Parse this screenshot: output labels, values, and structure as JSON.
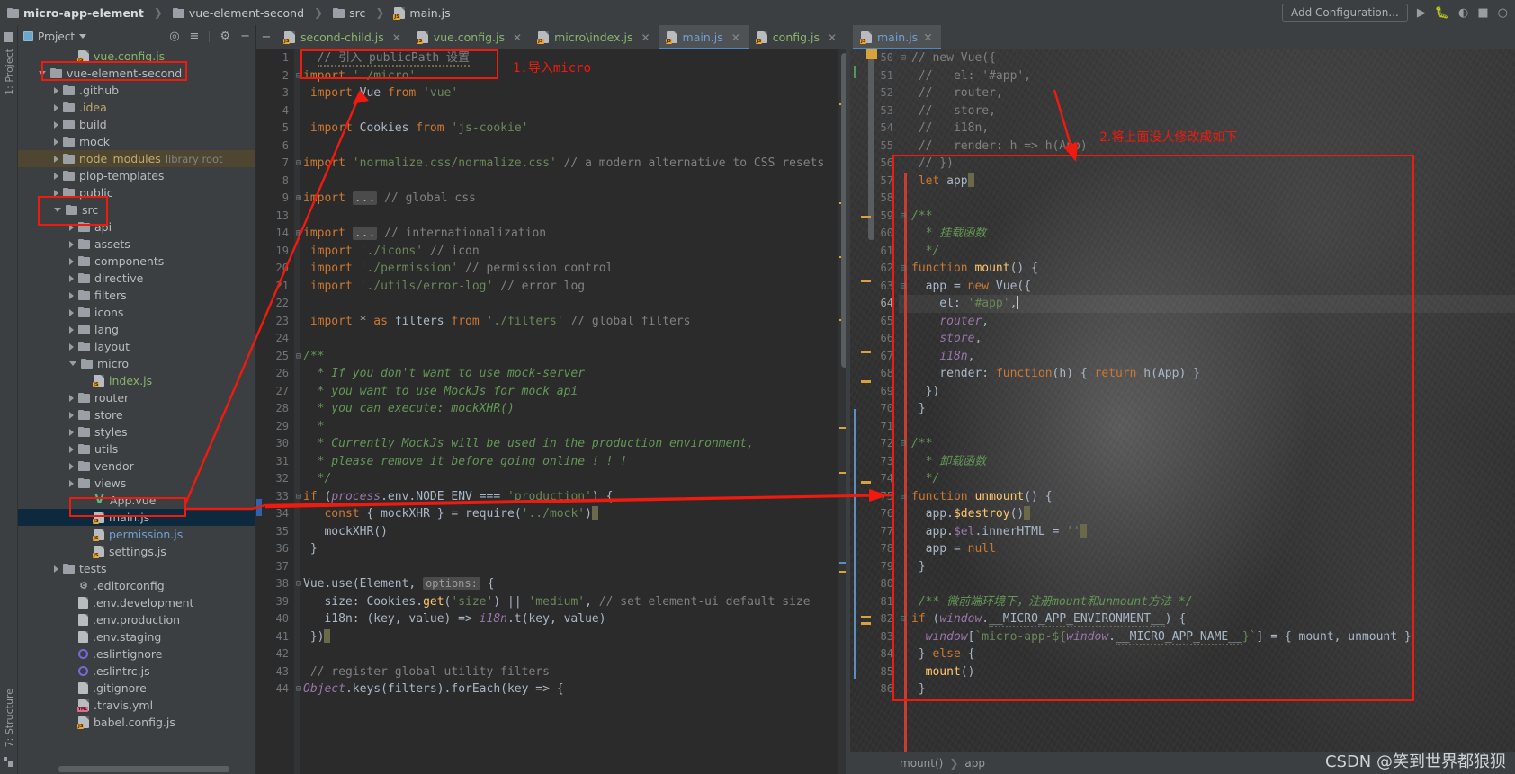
{
  "window": {
    "breadcrumb": [
      "micro-app-element",
      "vue-element-second",
      "src",
      "main.js"
    ],
    "add_configuration": "Add Configuration...",
    "run_icon": "run-icon",
    "debug_icon": "debug-icon",
    "coverage_icon": "run-with-coverage-icon",
    "stop_icon": "stop-icon",
    "search_icon": "search-icon"
  },
  "left_strip": {
    "project_label": "1: Project",
    "structure_label": "7: Structure"
  },
  "project_panel": {
    "title": "Project",
    "actions": [
      "locate-icon",
      "collapse-all-icon",
      "gear-icon",
      "hide-icon"
    ],
    "tree": [
      {
        "label": "vue.config.js",
        "indent": 3,
        "arrow": "none",
        "icon": "js",
        "color": "green"
      },
      {
        "label": "vue-element-second",
        "indent": 1,
        "arrow": "open",
        "icon": "folder",
        "color": "plain"
      },
      {
        "label": ".github",
        "indent": 2,
        "arrow": "closed",
        "icon": "folder",
        "color": "plain"
      },
      {
        "label": ".idea",
        "indent": 2,
        "arrow": "closed",
        "icon": "folder",
        "color": "yellow"
      },
      {
        "label": "build",
        "indent": 2,
        "arrow": "closed",
        "icon": "folder",
        "color": "plain"
      },
      {
        "label": "mock",
        "indent": 2,
        "arrow": "closed",
        "icon": "folder",
        "color": "plain"
      },
      {
        "label": "node_modules",
        "sub": "library root",
        "indent": 2,
        "arrow": "closed",
        "icon": "folder",
        "color": "yellow",
        "highlight": true
      },
      {
        "label": "plop-templates",
        "indent": 2,
        "arrow": "closed",
        "icon": "folder",
        "color": "plain"
      },
      {
        "label": "public",
        "indent": 2,
        "arrow": "closed",
        "icon": "folder",
        "color": "plain"
      },
      {
        "label": "src",
        "indent": 2,
        "arrow": "open",
        "icon": "folder",
        "color": "plain"
      },
      {
        "label": "api",
        "indent": 3,
        "arrow": "closed",
        "icon": "folder",
        "color": "plain"
      },
      {
        "label": "assets",
        "indent": 3,
        "arrow": "closed",
        "icon": "folder",
        "color": "plain"
      },
      {
        "label": "components",
        "indent": 3,
        "arrow": "closed",
        "icon": "folder",
        "color": "plain"
      },
      {
        "label": "directive",
        "indent": 3,
        "arrow": "closed",
        "icon": "folder",
        "color": "plain"
      },
      {
        "label": "filters",
        "indent": 3,
        "arrow": "closed",
        "icon": "folder",
        "color": "plain"
      },
      {
        "label": "icons",
        "indent": 3,
        "arrow": "closed",
        "icon": "folder",
        "color": "plain"
      },
      {
        "label": "lang",
        "indent": 3,
        "arrow": "closed",
        "icon": "folder",
        "color": "plain"
      },
      {
        "label": "layout",
        "indent": 3,
        "arrow": "closed",
        "icon": "folder",
        "color": "plain"
      },
      {
        "label": "micro",
        "indent": 3,
        "arrow": "open",
        "icon": "folder",
        "color": "plain"
      },
      {
        "label": "index.js",
        "indent": 4,
        "arrow": "none",
        "icon": "js",
        "color": "green"
      },
      {
        "label": "router",
        "indent": 3,
        "arrow": "closed",
        "icon": "folder",
        "color": "plain"
      },
      {
        "label": "store",
        "indent": 3,
        "arrow": "closed",
        "icon": "folder",
        "color": "plain"
      },
      {
        "label": "styles",
        "indent": 3,
        "arrow": "closed",
        "icon": "folder",
        "color": "plain"
      },
      {
        "label": "utils",
        "indent": 3,
        "arrow": "closed",
        "icon": "folder",
        "color": "plain"
      },
      {
        "label": "vendor",
        "indent": 3,
        "arrow": "closed",
        "icon": "folder",
        "color": "plain"
      },
      {
        "label": "views",
        "indent": 3,
        "arrow": "closed",
        "icon": "folder",
        "color": "plain"
      },
      {
        "label": "App.vue",
        "indent": 4,
        "arrow": "none",
        "icon": "vue",
        "color": "plain"
      },
      {
        "label": "main.js",
        "indent": 4,
        "arrow": "none",
        "icon": "js",
        "color": "plain",
        "selected": true
      },
      {
        "label": "permission.js",
        "indent": 4,
        "arrow": "none",
        "icon": "js",
        "color": "blue"
      },
      {
        "label": "settings.js",
        "indent": 4,
        "arrow": "none",
        "icon": "js",
        "color": "plain"
      },
      {
        "label": "tests",
        "indent": 2,
        "arrow": "closed",
        "icon": "folder",
        "color": "plain"
      },
      {
        "label": ".editorconfig",
        "indent": 3,
        "arrow": "none",
        "icon": "gear",
        "color": "plain"
      },
      {
        "label": ".env.development",
        "indent": 3,
        "arrow": "none",
        "icon": "doc",
        "color": "plain"
      },
      {
        "label": ".env.production",
        "indent": 3,
        "arrow": "none",
        "icon": "doc",
        "color": "plain"
      },
      {
        "label": ".env.staging",
        "indent": 3,
        "arrow": "none",
        "icon": "doc",
        "color": "plain"
      },
      {
        "label": ".eslintignore",
        "indent": 3,
        "arrow": "none",
        "icon": "circle",
        "color": "plain"
      },
      {
        "label": ".eslintrc.js",
        "indent": 3,
        "arrow": "none",
        "icon": "circle",
        "color": "plain"
      },
      {
        "label": ".gitignore",
        "indent": 3,
        "arrow": "none",
        "icon": "gitdoc",
        "color": "plain"
      },
      {
        "label": ".travis.yml",
        "indent": 3,
        "arrow": "none",
        "icon": "yml",
        "color": "plain"
      },
      {
        "label": "babel.config.js",
        "indent": 3,
        "arrow": "none",
        "icon": "js",
        "color": "plain"
      }
    ]
  },
  "tabs": [
    {
      "label": "second-child.js",
      "color": "green",
      "active": false
    },
    {
      "label": "vue.config.js",
      "color": "green",
      "active": false
    },
    {
      "label": "micro\\index.js",
      "color": "green",
      "active": false
    },
    {
      "label": "main.js",
      "color": "blue",
      "active": true
    },
    {
      "label": "config.js",
      "color": "green",
      "active": false
    }
  ],
  "right_tab": {
    "label": "main.js",
    "color": "blue"
  },
  "left_editor": {
    "lines": [
      {
        "n": "1",
        "fold": "",
        "html": "  <span class='cmt sq-wavy'>// 引入 publicPath 设置</span>"
      },
      {
        "n": "2",
        "fold": "-",
        "html": "<span class='kw'>import</span> <span class='str'>'./micro'</span>"
      },
      {
        "n": "3",
        "fold": "",
        "html": " <span class='kw'>import</span> Vue <span class='kw'>from</span> <span class='str'>'vue'</span>"
      },
      {
        "n": "4",
        "fold": "",
        "html": ""
      },
      {
        "n": "5",
        "fold": "",
        "html": " <span class='kw'>import</span> Cookies <span class='kw'>from</span> <span class='str'>'js-cookie'</span>"
      },
      {
        "n": "6",
        "fold": "",
        "html": ""
      },
      {
        "n": "7",
        "fold": "-",
        "html": "<span class='kw'>import</span> <span class='str'>'normalize.css/normalize.css'</span> <span class='cmt'>// a modern alternative to CSS resets</span>"
      },
      {
        "n": "8",
        "fold": "",
        "html": ""
      },
      {
        "n": "9",
        "fold": "+",
        "html": "<span class='kw'>import</span> <span class='folded'>...</span> <span class='cmt'>// global css</span>"
      },
      {
        "n": "13",
        "fold": "",
        "html": ""
      },
      {
        "n": "14",
        "fold": "+",
        "html": "<span class='kw'>import</span> <span class='folded'>...</span> <span class='cmt'>// internationalization</span>"
      },
      {
        "n": "19",
        "fold": "",
        "html": " <span class='kw'>import</span> <span class='str'>'./icons'</span> <span class='cmt'>// icon</span>"
      },
      {
        "n": "20",
        "fold": "",
        "html": " <span class='kw'>import</span> <span class='str'>'./permission'</span> <span class='cmt'>// permission control</span>"
      },
      {
        "n": "21",
        "fold": "",
        "html": " <span class='kw'>import</span> <span class='str'>'./utils/error-log'</span> <span class='cmt'>// error log</span>"
      },
      {
        "n": "22",
        "fold": "",
        "html": ""
      },
      {
        "n": "23",
        "fold": "",
        "html": " <span class='kw'>import</span> * <span class='kw'>as</span> filters <span class='kw'>from</span> <span class='str'>'./filters'</span> <span class='cmt'>// global filters</span>"
      },
      {
        "n": "24",
        "fold": "",
        "html": ""
      },
      {
        "n": "25",
        "fold": "-",
        "html": "<span class='cmt-doc'>/**</span>"
      },
      {
        "n": "26",
        "fold": "",
        "html": " <span class='cmt-doc'> * If you don't want to use mock-server</span>"
      },
      {
        "n": "27",
        "fold": "",
        "html": " <span class='cmt-doc'> * you want to use MockJs for mock api</span>"
      },
      {
        "n": "28",
        "fold": "",
        "html": " <span class='cmt-doc'> * you can execute: mockXHR()</span>"
      },
      {
        "n": "29",
        "fold": "",
        "html": " <span class='cmt-doc'> *</span>"
      },
      {
        "n": "30",
        "fold": "",
        "html": " <span class='cmt-doc'> * Currently MockJs will be used in the production environment,</span>"
      },
      {
        "n": "31",
        "fold": "",
        "html": " <span class='cmt-doc'> * please remove it before going online ! ! !</span>"
      },
      {
        "n": "32",
        "fold": "⌐",
        "html": " <span class='cmt-doc'> */</span>"
      },
      {
        "n": "33",
        "fold": "-",
        "html": "<span class='kw'>if</span> (<span class='ital'>process</span>.env.NODE_ENV === <span class='str'>'production'</span>) {"
      },
      {
        "n": "34",
        "fold": "",
        "html": "   <span class='kw'>const</span> { mockXHR } = <span class='plain'>require</span>(<span class='str'>'../mock'</span>)<span class='caret-blk'></span>"
      },
      {
        "n": "35",
        "fold": "",
        "html": "   mockXHR()"
      },
      {
        "n": "36",
        "fold": "⌐",
        "html": " }"
      },
      {
        "n": "37",
        "fold": "",
        "html": ""
      },
      {
        "n": "38",
        "fold": "-",
        "html": "Vue.use(Element, <span class='inline-hint'>options:</span> {"
      },
      {
        "n": "39",
        "fold": "",
        "html": "   size: Cookies.<span class='fn'>get</span>(<span class='str'>'size'</span>) || <span class='str'>'medium'</span>, <span class='cmt'>// set element-ui default size</span>"
      },
      {
        "n": "40",
        "fold": "",
        "html": "   i18n: (key, value) =&gt; <span class='ital'>i18n</span>.t(key, value)"
      },
      {
        "n": "41",
        "fold": "⌐",
        "html": " })<span class='caret-blk'></span>"
      },
      {
        "n": "42",
        "fold": "",
        "html": ""
      },
      {
        "n": "43",
        "fold": "",
        "html": " <span class='cmt'>// register global utility filters</span>"
      },
      {
        "n": "44",
        "fold": "-",
        "html": "<span class='ital'>Object</span>.keys(filters).forEach(key =&gt; {"
      }
    ]
  },
  "right_editor": {
    "lines": [
      {
        "n": "50",
        "fold": "-",
        "html": "<span class='cmt'>// new Vue({</span>"
      },
      {
        "n": "51",
        "fold": "",
        "html": " <span class='cmt'>//   el: '#app',</span>"
      },
      {
        "n": "52",
        "fold": "",
        "html": " <span class='cmt'>//   router,</span>"
      },
      {
        "n": "53",
        "fold": "",
        "html": " <span class='cmt'>//   store,</span>"
      },
      {
        "n": "54",
        "fold": "",
        "html": " <span class='cmt'>//   i18n,</span>"
      },
      {
        "n": "55",
        "fold": "",
        "html": " <span class='cmt'>//   render: h =&gt; h(App)</span>"
      },
      {
        "n": "56",
        "fold": "⌐",
        "html": " <span class='cmt'>// })</span>"
      },
      {
        "n": "57",
        "fold": "",
        "html": " <span class='kw'>let</span> app<span class='caret-blk'></span>"
      },
      {
        "n": "58",
        "fold": "",
        "html": ""
      },
      {
        "n": "59",
        "fold": "-",
        "html": "<span class='cmt-doc'>/**</span>"
      },
      {
        "n": "60",
        "fold": "",
        "html": " <span class='cmt-doc'> * 挂载函数</span>"
      },
      {
        "n": "61",
        "fold": "⌐",
        "html": " <span class='cmt-doc'> */</span>"
      },
      {
        "n": "62",
        "fold": "-",
        "html": "<span class='kw'>function</span> <span class='fn'>mount</span>() {"
      },
      {
        "n": "63",
        "fold": "-",
        "html": "  app = <span class='kw'>new</span> Vue({"
      },
      {
        "n": "64",
        "fold": "",
        "html": "    el: <span class='str'>'#app'</span>,<span class='caret-blk' style='width:2px;background:#c8c8c8'></span>"
      },
      {
        "n": "65",
        "fold": "",
        "html": "    <span class='ital'>router</span>,"
      },
      {
        "n": "66",
        "fold": "",
        "html": "    <span class='ital'>store</span>,"
      },
      {
        "n": "67",
        "fold": "",
        "html": "    <span class='ital'>i18n</span>,"
      },
      {
        "n": "68",
        "fold": "",
        "html": "    render: <span class='kw'>function</span>(h) { <span class='kw'>return</span> h(App) }"
      },
      {
        "n": "69",
        "fold": "⌐",
        "html": "  })"
      },
      {
        "n": "70",
        "fold": "⌐",
        "html": " }"
      },
      {
        "n": "71",
        "fold": "",
        "html": ""
      },
      {
        "n": "72",
        "fold": "-",
        "html": "<span class='cmt-doc'>/**</span>"
      },
      {
        "n": "73",
        "fold": "",
        "html": " <span class='cmt-doc'> * 卸载函数</span>"
      },
      {
        "n": "74",
        "fold": "⌐",
        "html": " <span class='cmt-doc'> */</span>"
      },
      {
        "n": "75",
        "fold": "-",
        "html": "<span class='kw'>function</span> <span class='fn'>unmount</span>() {"
      },
      {
        "n": "76",
        "fold": "",
        "html": "  app.<span class='fn'>$destroy</span>()<span class='caret-blk'></span>"
      },
      {
        "n": "77",
        "fold": "",
        "html": "  app.<span class='field'>$el</span>.innerHTML = <span class='str'>''</span><span class='caret-blk'></span>"
      },
      {
        "n": "78",
        "fold": "",
        "html": "  app = <span class='kw'>null</span>"
      },
      {
        "n": "79",
        "fold": "⌐",
        "html": " }"
      },
      {
        "n": "80",
        "fold": "",
        "html": ""
      },
      {
        "n": "81",
        "fold": "",
        "html": " <span class='cmt-doc'>/** 微前端环境下，注册mount和unmount方法 */</span>"
      },
      {
        "n": "82",
        "fold": "-",
        "html": "<span class='kw'>if</span> (<span class='ital'>window</span>.<span class='sq-wavy'>__MICRO_APP_ENVIRONMENT__</span>) {"
      },
      {
        "n": "83",
        "fold": "",
        "html": "  <span class='ital'>window</span>[<span class='str'>`micro-app-${</span><span class='ital'>window</span>.<span class='sq-wavy'>__MICRO_APP_NAME__</span><span class='str'>}`</span>] = { mount, unmount }"
      },
      {
        "n": "84",
        "fold": "⌐",
        "html": " } <span class='kw'>else</span> {"
      },
      {
        "n": "85",
        "fold": "",
        "html": "  <span class='fn'>mount</span>()"
      },
      {
        "n": "86",
        "fold": "⌐",
        "html": " }"
      }
    ],
    "breadcrumb": [
      "mount()",
      "app"
    ]
  },
  "annotations": {
    "note1": "1.导入micro",
    "note2": "2.将上面没人修改成如下",
    "color": "#f01a0f"
  },
  "watermark": "CSDN @笑到世界都狼狈"
}
